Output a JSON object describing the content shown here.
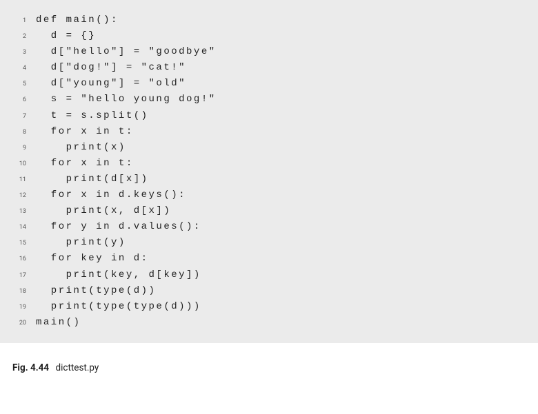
{
  "code": {
    "lines": [
      {
        "num": "1",
        "text": "def main():"
      },
      {
        "num": "2",
        "text": "  d = {}"
      },
      {
        "num": "3",
        "text": "  d[\"hello\"] = \"goodbye\""
      },
      {
        "num": "4",
        "text": "  d[\"dog!\"] = \"cat!\""
      },
      {
        "num": "5",
        "text": "  d[\"young\"] = \"old\""
      },
      {
        "num": "6",
        "text": "  s = \"hello young dog!\""
      },
      {
        "num": "7",
        "text": "  t = s.split()"
      },
      {
        "num": "8",
        "text": "  for x in t:"
      },
      {
        "num": "9",
        "text": "    print(x)"
      },
      {
        "num": "10",
        "text": "  for x in t:"
      },
      {
        "num": "11",
        "text": "    print(d[x])"
      },
      {
        "num": "12",
        "text": "  for x in d.keys():"
      },
      {
        "num": "13",
        "text": "    print(x, d[x])"
      },
      {
        "num": "14",
        "text": "  for y in d.values():"
      },
      {
        "num": "15",
        "text": "    print(y)"
      },
      {
        "num": "16",
        "text": "  for key in d:"
      },
      {
        "num": "17",
        "text": "    print(key, d[key])"
      },
      {
        "num": "18",
        "text": "  print(type(d))"
      },
      {
        "num": "19",
        "text": "  print(type(type(d)))"
      },
      {
        "num": "20",
        "text": "main()"
      }
    ]
  },
  "caption": {
    "label": "Fig. 4.44",
    "text": "dicttest.py"
  }
}
